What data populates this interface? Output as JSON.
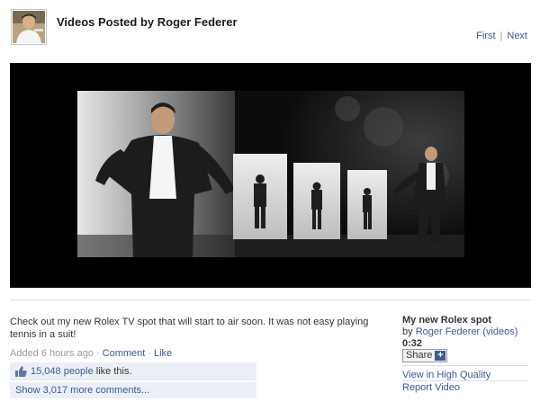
{
  "header": {
    "title": "Videos Posted by Roger Federer",
    "pager": {
      "first": "First",
      "separator": "|",
      "next": "Next"
    }
  },
  "post": {
    "description": "Check out my new Rolex TV spot that will start to air soon. It was not easy playing tennis in a suit!",
    "added": "Added 6 hours ago",
    "comment_link": "Comment",
    "like_link": "Like",
    "meta_separator": "·",
    "likes_count": "15,048 people",
    "likes_suffix": " like this.",
    "show_comments": "Show 3,017 more comments..."
  },
  "video": {
    "title": "My new Rolex spot",
    "by": "by ",
    "author": "Roger Federer",
    "videos_link": "(videos)",
    "duration": "0:32",
    "share_label": "Share",
    "share_plus": "+",
    "view_hq": "View in High Quality",
    "report": "Report Video"
  },
  "icons": {
    "thumbs_up": "thumbs-up-icon",
    "play_area": "video-player"
  },
  "colors": {
    "link": "#3b5998",
    "likes_bg": "#eceff5",
    "player_bg": "#000000"
  }
}
